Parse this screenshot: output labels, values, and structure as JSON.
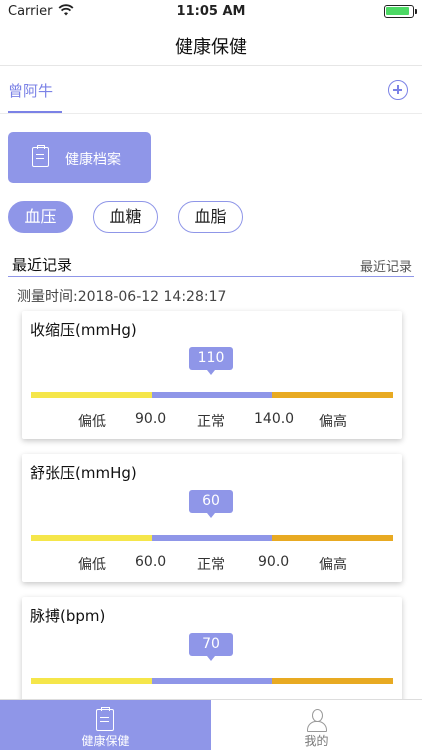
{
  "status_bar": {
    "carrier": "Carrier",
    "time": "11:05 AM"
  },
  "nav": {
    "title": "健康保健"
  },
  "member": {
    "name": "曾阿牛"
  },
  "health_file_button": {
    "label": "健康档案"
  },
  "chips": [
    "血压",
    "血糖",
    "血脂"
  ],
  "active_chip": "血压",
  "section": {
    "title": "最近记录",
    "more": "最近记录"
  },
  "measure_time": "测量时间:2018-06-12 14:28:17",
  "cards": [
    {
      "title": "收缩压(mmHg)",
      "value": "110",
      "low_label": "偏低",
      "low_threshold": "90.0",
      "normal_label": "正常",
      "high_threshold": "140.0",
      "high_label": "偏高"
    },
    {
      "title": "舒张压(mmHg)",
      "value": "60",
      "low_label": "偏低",
      "low_threshold": "60.0",
      "normal_label": "正常",
      "high_threshold": "90.0",
      "high_label": "偏高"
    },
    {
      "title": "脉搏(bpm)",
      "value": "70"
    }
  ],
  "colors": {
    "accent": "#8f96e8",
    "low": "#f5e64a",
    "high": "#e8aa22",
    "battery": "#4cd964"
  },
  "tabs": [
    {
      "label": "健康保健",
      "icon": "health-file-icon",
      "active": true
    },
    {
      "label": "我的",
      "icon": "user-icon",
      "active": false
    }
  ]
}
